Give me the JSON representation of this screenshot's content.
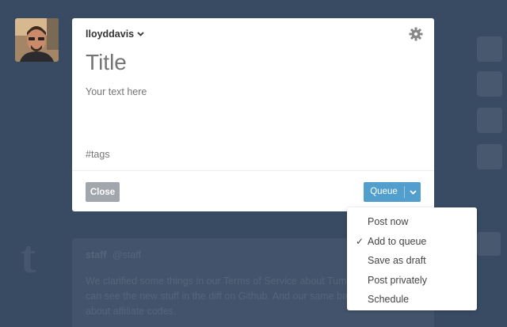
{
  "app": {
    "background_color": "#36465d",
    "accent_color": "#529ecc"
  },
  "composer": {
    "blog_name": "lloyddavis",
    "title_placeholder": "Title",
    "body_placeholder": "Your text here",
    "tags_placeholder": "#tags",
    "close_label": "Close",
    "submit_label": "Queue"
  },
  "post_menu": {
    "items": [
      {
        "label": "Post now",
        "checked": false
      },
      {
        "label": "Add to queue",
        "checked": true
      },
      {
        "label": "Save as draft",
        "checked": false
      },
      {
        "label": "Post privately",
        "checked": false
      },
      {
        "label": "Schedule",
        "checked": false
      }
    ]
  },
  "background": {
    "post_author": "staff",
    "post_handle": "@staff",
    "post_text": "We clarified some things in our Terms of Service about Tumblr codes. You can see the new stuff in the diff on Github. And our same basic questions about affiliate codes."
  }
}
